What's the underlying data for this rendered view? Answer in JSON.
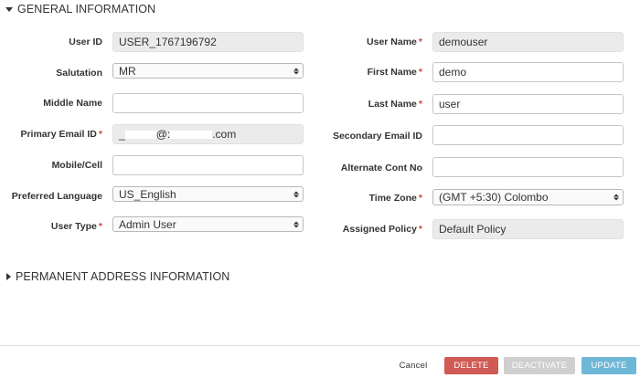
{
  "sections": {
    "general": "GENERAL INFORMATION",
    "permanent_address": "PERMANENT ADDRESS INFORMATION"
  },
  "left": {
    "user_id": {
      "label": "User ID",
      "value": "USER_1767196792"
    },
    "salutation": {
      "label": "Salutation",
      "value": "MR"
    },
    "middle_name": {
      "label": "Middle Name",
      "value": ""
    },
    "primary_email": {
      "label": "Primary Email ID",
      "value_prefix": "_",
      "value_mid": "@:",
      "value_suffix": ".com"
    },
    "mobile": {
      "label": "Mobile/Cell",
      "value": ""
    },
    "preferred_language": {
      "label": "Preferred Language",
      "value": "US_English"
    },
    "user_type": {
      "label": "User Type",
      "value": "Admin User"
    }
  },
  "right": {
    "user_name": {
      "label": "User Name",
      "value": "demouser"
    },
    "first_name": {
      "label": "First Name",
      "value": "demo"
    },
    "last_name": {
      "label": "Last Name",
      "value": "user"
    },
    "secondary_email": {
      "label": "Secondary Email ID",
      "value": ""
    },
    "alternate_contact": {
      "label": "Alternate Cont No",
      "value": ""
    },
    "time_zone": {
      "label": "Time Zone",
      "value": "(GMT +5:30) Colombo"
    },
    "assigned_policy": {
      "label": "Assigned Policy",
      "value": "Default Policy"
    }
  },
  "required_marker": "*",
  "actions": {
    "cancel": "Cancel",
    "delete": "DELETE",
    "deactivate": "DEACTIVATE",
    "update": "UPDATE"
  },
  "colors": {
    "required": "#d0433a",
    "delete": "#d05a54",
    "deactivate": "#cfcfcf",
    "update": "#6fb7d6"
  },
  "icons": {
    "section_expanded": "triangle-down-icon",
    "section_collapsed": "triangle-right-icon",
    "select_arrows": "updown-arrows-icon"
  }
}
